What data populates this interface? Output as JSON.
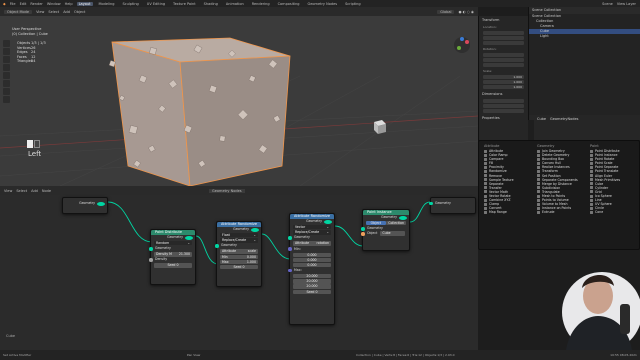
{
  "topbar": {
    "menus": [
      "File",
      "Edit",
      "Render",
      "Window",
      "Help"
    ],
    "workspaces": [
      "Layout",
      "Modeling",
      "Sculpting",
      "UV Editing",
      "Texture Paint",
      "Shading",
      "Animation",
      "Rendering",
      "Compositing",
      "Geometry Nodes",
      "Scripting"
    ],
    "active_workspace": "Layout",
    "scene_label": "Scene",
    "viewlayer_label": "View Layer"
  },
  "viewport": {
    "mode": "Object Mode",
    "menus": [
      "View",
      "Select",
      "Add",
      "Object"
    ],
    "transform": "Global",
    "info_line1": "User Perspective",
    "info_line2": "(0) Collection | Cube",
    "stats": [
      {
        "label": "Objects",
        "value": "1/3 | 1/3"
      },
      {
        "label": "Vertices",
        "value": "26"
      },
      {
        "label": "Edges",
        "value": "24"
      },
      {
        "label": "Faces",
        "value": "12"
      },
      {
        "label": "Triangles",
        "value": "24"
      }
    ],
    "key_label": "Left"
  },
  "npanel": {
    "transform_title": "Transform",
    "dimensions_title": "Dimensions",
    "properties_title": "Properties",
    "location_label": "Location:",
    "rotation_label": "Rotation:",
    "scale_label": "Scale:",
    "scale_values": [
      "1.000",
      "1.000",
      "1.000"
    ],
    "tabs": [
      "Item",
      "Tool",
      "View"
    ]
  },
  "outliner": {
    "title": "Scene Collection",
    "items": [
      {
        "label": "Scene Collection",
        "selected": false
      },
      {
        "label": "Collection",
        "selected": false
      },
      {
        "label": "Camera",
        "selected": false
      },
      {
        "label": "Cube",
        "selected": true
      },
      {
        "label": "Light",
        "selected": false
      }
    ]
  },
  "properties": {
    "object_name": "Cube",
    "modifier": "GeometryNodes"
  },
  "add_menu": {
    "title": "Add Node",
    "columns": [
      {
        "header": "Attribute",
        "items": [
          "Attribute",
          "Color Ramp",
          "Compare",
          "Fill",
          "Proximity",
          "Randomize",
          "Remove",
          "Sample Texture",
          "Separate",
          "Transfer",
          "Vector Math",
          "Vector Rotate",
          "Combine XYZ",
          "Clamp",
          "Convert",
          "Map Range"
        ]
      },
      {
        "header": "Geometry",
        "items": [
          "Join Geometry",
          "Delete Geometry",
          "Bounding Box",
          "Convex Hull",
          "Realize Instances",
          "Transform",
          "Set Position",
          "Separate Components",
          "Merge by Distance",
          "Subdivision",
          "Triangulate",
          "Mesh to Points",
          "Points to Volume",
          "Volume to Mesh",
          "Instance on Points",
          "Extrude"
        ]
      },
      {
        "header": "Point",
        "items": [
          "Point Distribute",
          "Point Instance",
          "Point Rotate",
          "Point Scale",
          "Point Separate",
          "Point Translate",
          "Align Euler",
          "Mesh Primitives",
          "Cube",
          "Cylinder",
          "Grid",
          "Ico Sphere",
          "Line",
          "UV Sphere",
          "Circle",
          "Cone"
        ]
      }
    ]
  },
  "node_editor": {
    "menus": [
      "View",
      "Select",
      "Add",
      "Node"
    ],
    "tree_name": "Geometry Nodes",
    "group_input": {
      "socket": "Geometry"
    },
    "group_output": {
      "socket": "Geometry"
    },
    "nodes": {
      "point_distribute": {
        "title": "Point Distribute",
        "output": "Geometry",
        "mode": "Random",
        "input_geometry": "Geometry",
        "density_max_label": "Density M",
        "density_max_value": "21.300",
        "density_label": "Density",
        "seed_label": "Seed",
        "seed_value": "0"
      },
      "attr_randomize_1": {
        "title": "Attribute Randomize",
        "output": "Geometry",
        "type": "Float",
        "mode": "Replace/Create",
        "input_geometry": "Geometry",
        "attribute_label": "Attribute",
        "attribute_value": "scale",
        "min_label": "Min",
        "min_value": "0.000",
        "max_label": "Max",
        "max_value": "1.000",
        "seed_label": "Seed",
        "seed_value": "0"
      },
      "attr_randomize_2": {
        "title": "Attribute Randomize",
        "output": "Geometry",
        "type": "Vector",
        "mode": "Replace/Create",
        "input_geometry": "Geometry",
        "attribute_label": "Attribute",
        "attribute_value": "rotation",
        "min_label": "Min:",
        "min_values": [
          "0.000",
          "0.000",
          "0.000"
        ],
        "max_label": "Max:",
        "max_values": [
          "20.000",
          "20.000",
          "20.000"
        ],
        "seed_label": "Seed",
        "seed_value": "0"
      },
      "point_instance": {
        "title": "Point Instance",
        "output": "Geometry",
        "tab_object": "Object",
        "tab_collection": "Collection",
        "input_geometry": "Geometry",
        "object_label": "Object",
        "object_value": "Cube"
      }
    },
    "footer": "Cube"
  },
  "statusbar": {
    "left": "Set Active Modifier",
    "mid": "Pan View",
    "right": "Collection | Cube | Verts:8 | Faces:6 | Tris:12 | Objects:1/3 | 2.93.0",
    "time": "10:55",
    "date": "08.05.2021"
  },
  "colors": {
    "geometry_node_header": "#2c8a6c",
    "attribute_node_header": "#3a6fa3",
    "geometry_socket": "#00d6a3",
    "selection_orange": "#f0954a",
    "viewport_bg": "#3b3b3b"
  }
}
